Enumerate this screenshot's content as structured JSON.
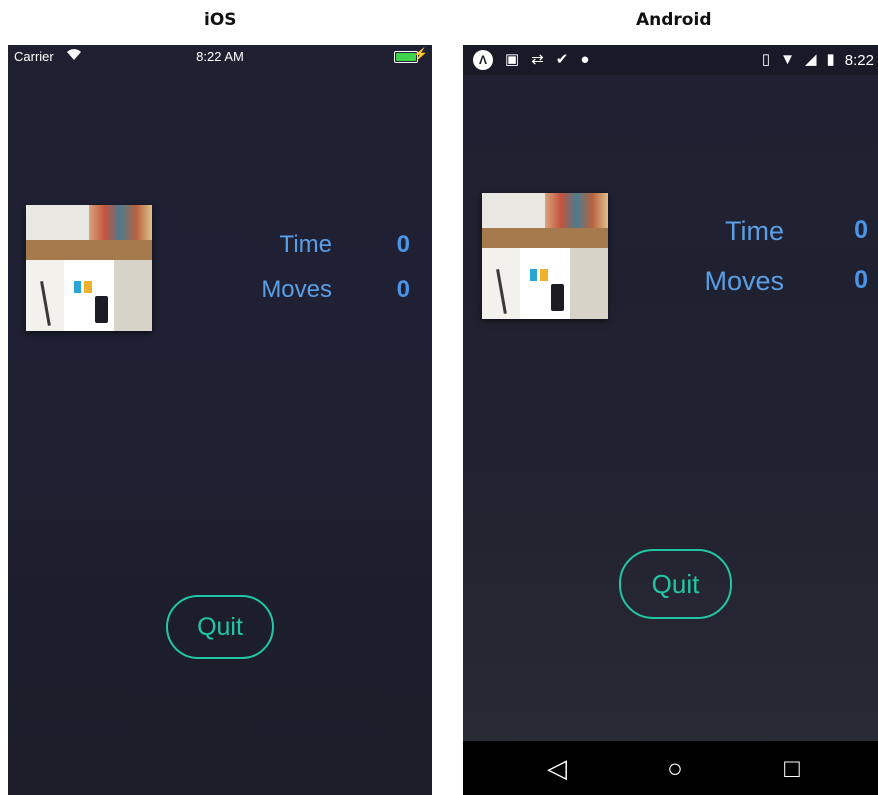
{
  "titles": {
    "ios": "iOS",
    "android": "Android"
  },
  "ios": {
    "status": {
      "carrier": "Carrier",
      "time": "8:22 AM",
      "battery_level": 0.9
    },
    "stats": {
      "time_label": "Time",
      "time_value": "0",
      "moves_label": "Moves",
      "moves_value": "0"
    },
    "quit_label": "Quit"
  },
  "android": {
    "status": {
      "time": "8:22"
    },
    "stats": {
      "time_label": "Time",
      "time_value": "0",
      "moves_label": "Moves",
      "moves_value": "0"
    },
    "quit_label": "Quit",
    "nav": {
      "back_icon": "◁",
      "home_icon": "○",
      "recents_icon": "□"
    }
  },
  "colors": {
    "accent": "#20c7a6",
    "label_blue": "#5a9ee6",
    "value_blue": "#4a95e8",
    "background": "#1f2032"
  }
}
